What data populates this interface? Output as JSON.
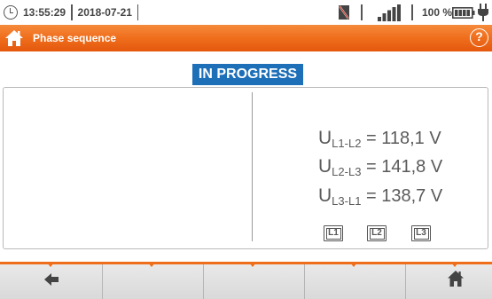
{
  "status": {
    "time": "13:55:29",
    "date": "2018-07-21",
    "battery_percent": "100 %",
    "signal_icon": "signal-bars-icon",
    "sd_icon": "sd-card-icon",
    "power_icon": "plug-icon"
  },
  "header": {
    "title": "Phase sequence",
    "home_icon": "home-icon",
    "help_label": "?"
  },
  "measurement": {
    "state": "IN PROGRESS",
    "readings": [
      {
        "symbol": "U",
        "sub": "L1-L2",
        "value": "= 118,1 V"
      },
      {
        "symbol": "U",
        "sub": "L2-L3",
        "value": "= 141,8 V"
      },
      {
        "symbol": "U",
        "sub": "L3-L1",
        "value": "= 138,7 V"
      }
    ],
    "phases": [
      "L1",
      "L2",
      "L3"
    ]
  },
  "colors": {
    "accent": "#ef6e1c",
    "badge": "#1d6fb8"
  },
  "footer": {
    "back_icon": "arrow-left-icon",
    "home_icon": "home-icon"
  }
}
